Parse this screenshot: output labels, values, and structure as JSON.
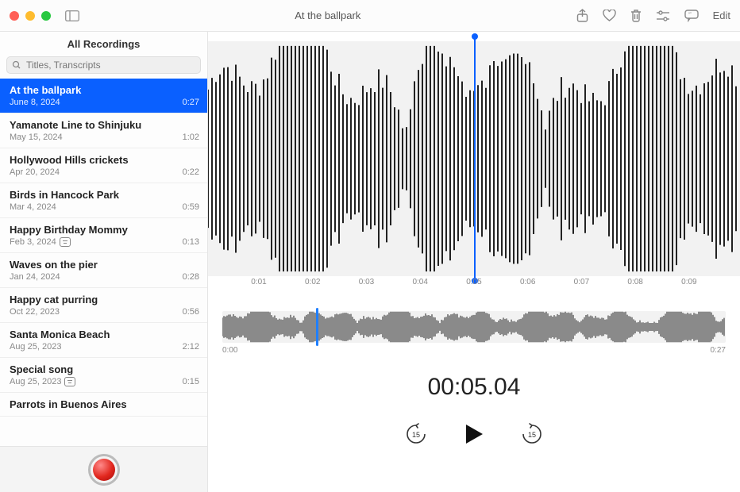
{
  "window": {
    "title": "At the ballpark",
    "edit_label": "Edit"
  },
  "sidebar": {
    "header": "All Recordings",
    "search_placeholder": "Titles, Transcripts",
    "items": [
      {
        "title": "At the ballpark",
        "date": "June 8, 2024",
        "duration": "0:27",
        "selected": true,
        "transcript": false
      },
      {
        "title": "Yamanote Line to Shinjuku",
        "date": "May 15, 2024",
        "duration": "1:02",
        "selected": false,
        "transcript": false
      },
      {
        "title": "Hollywood Hills crickets",
        "date": "Apr 20, 2024",
        "duration": "0:22",
        "selected": false,
        "transcript": false
      },
      {
        "title": "Birds in Hancock Park",
        "date": "Mar 4, 2024",
        "duration": "0:59",
        "selected": false,
        "transcript": false
      },
      {
        "title": "Happy Birthday Mommy",
        "date": "Feb 3, 2024",
        "duration": "0:13",
        "selected": false,
        "transcript": true
      },
      {
        "title": "Waves on the pier",
        "date": "Jan 24, 2024",
        "duration": "0:28",
        "selected": false,
        "transcript": false
      },
      {
        "title": "Happy cat purring",
        "date": "Oct 22, 2023",
        "duration": "0:56",
        "selected": false,
        "transcript": false
      },
      {
        "title": "Santa Monica Beach",
        "date": "Aug 25, 2023",
        "duration": "2:12",
        "selected": false,
        "transcript": false
      },
      {
        "title": "Special song",
        "date": "Aug 25, 2023",
        "duration": "0:15",
        "selected": false,
        "transcript": true
      },
      {
        "title": "Parrots in Buenos Aires",
        "date": "",
        "duration": "",
        "selected": false,
        "transcript": false
      }
    ]
  },
  "player": {
    "timecode": "00:05.04",
    "playhead_fraction": 0.186,
    "overview": {
      "start_label": "0:00",
      "end_label": "0:27"
    },
    "ruler_ticks": [
      "",
      "0:01",
      "0:02",
      "0:03",
      "0:04",
      "0:05",
      "0:06",
      "0:07",
      "0:08",
      "0:09",
      ""
    ],
    "skip_back_seconds": "15",
    "skip_forward_seconds": "15"
  },
  "icons": {
    "share": "share",
    "favorite": "heart",
    "delete": "trash",
    "settings": "sliders",
    "transcript": "speech",
    "sidebar": "sidebar"
  },
  "colors": {
    "accent": "#0a60ff"
  }
}
